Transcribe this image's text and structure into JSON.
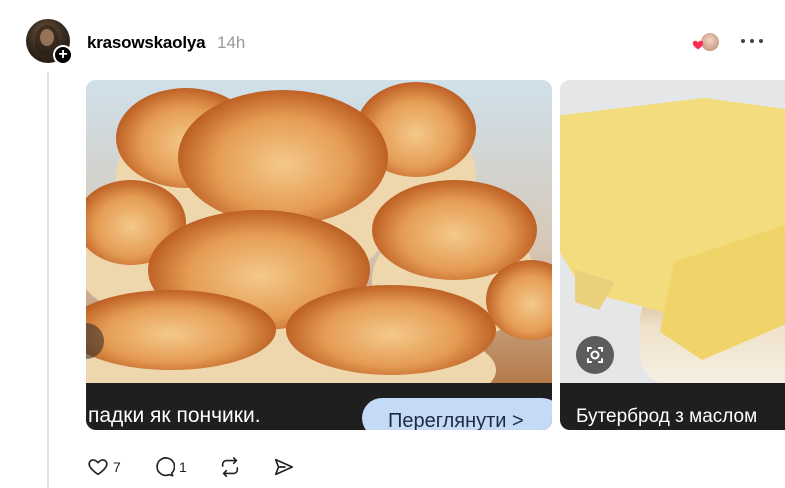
{
  "post": {
    "username": "krasowskaolya",
    "timestamp": "14h"
  },
  "media": [
    {
      "caption": "падки як пончики.",
      "cta_label": "Переглянути >"
    },
    {
      "caption": "Бутерброд з маслом"
    }
  ],
  "actions": {
    "like_count": "7",
    "reply_count": "1"
  },
  "icons": {
    "follow": "plus-icon",
    "liked_by": "heart-icon",
    "more": "more-horizontal-icon",
    "like": "heart-outline-icon",
    "reply": "comment-icon",
    "repost": "repost-icon",
    "share": "send-icon",
    "lens": "visual-search-icon"
  },
  "colors": {
    "heart_badge": "#ff2d55",
    "muted_text": "#999999",
    "cta_bg": "#c5daf6"
  }
}
